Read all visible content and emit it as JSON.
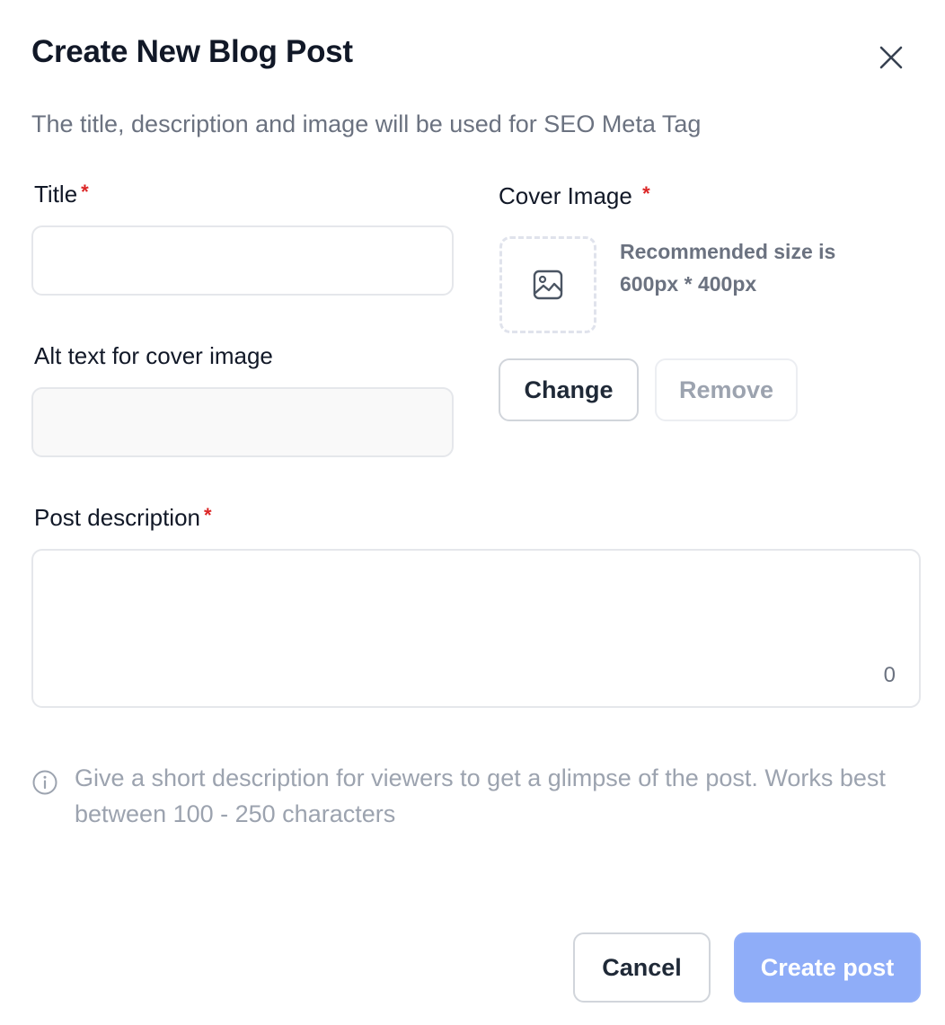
{
  "dialog": {
    "title": "Create New Blog Post",
    "subtitle": "The title, description and image will be used for SEO Meta Tag"
  },
  "form": {
    "title_label": "Title",
    "title_value": "",
    "alt_text_label": "Alt text for cover image",
    "alt_text_value": "",
    "cover_image_label": "Cover Image",
    "cover_image_hint_line1": "Recommended size is",
    "cover_image_hint_line2": "600px * 400px",
    "change_button": "Change",
    "remove_button": "Remove",
    "description_label": "Post description",
    "description_value": "",
    "char_count": "0",
    "required_marker": "*",
    "info_text": "Give a short description for viewers to get a glimpse of the post. Works best between 100 - 250 characters"
  },
  "footer": {
    "cancel_button": "Cancel",
    "create_button": "Create post"
  },
  "icons": {
    "close": "close-icon",
    "image": "image-icon",
    "info": "info-icon"
  },
  "colors": {
    "required": "#dc2626",
    "primary_disabled": "#8fadf8",
    "muted_text": "#9ca3af"
  }
}
